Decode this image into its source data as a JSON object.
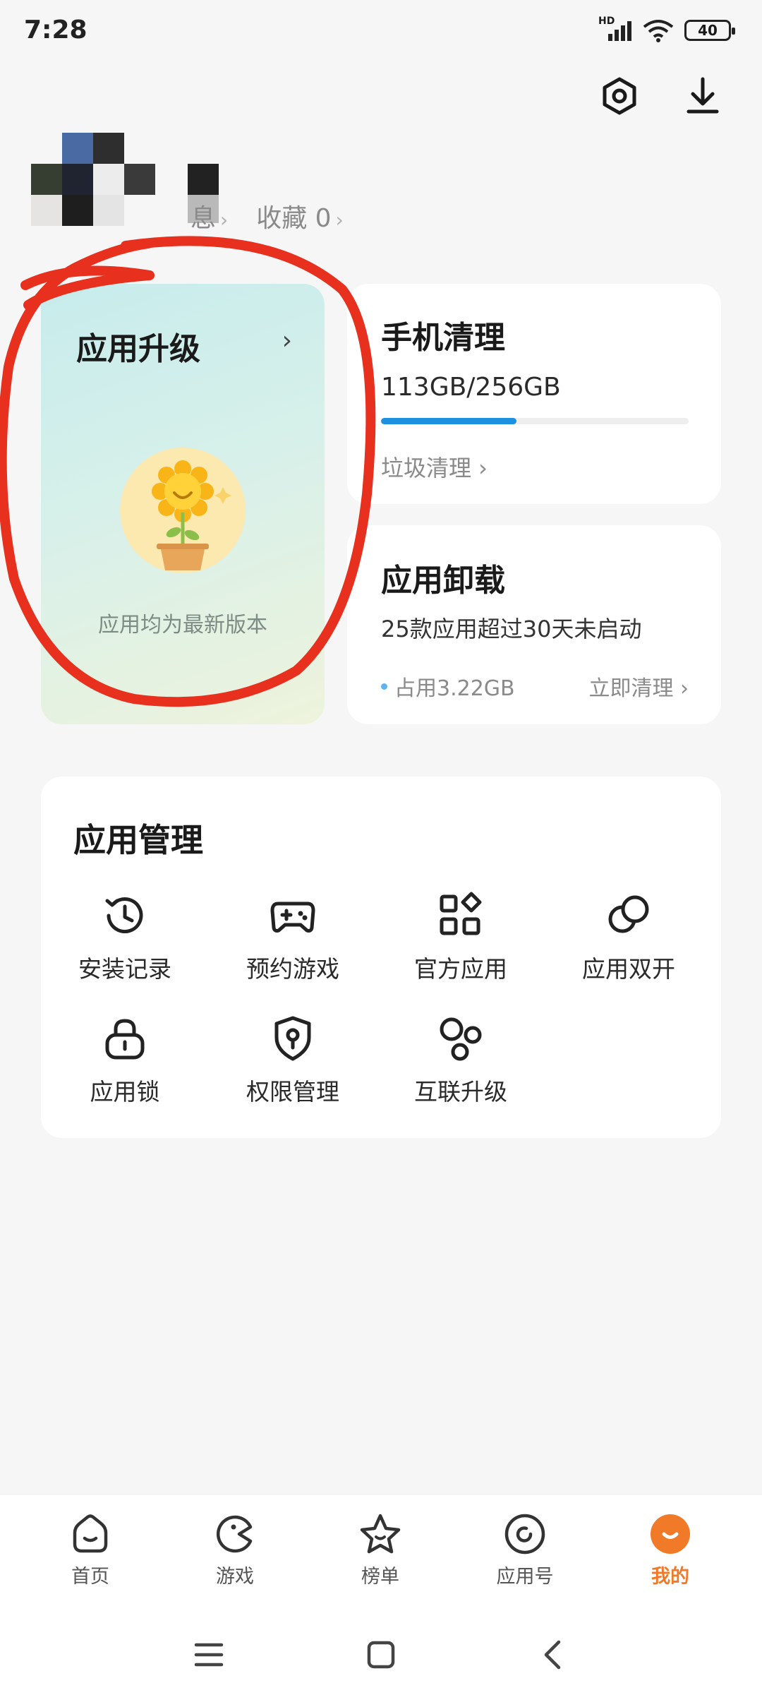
{
  "status_bar": {
    "time": "7:28",
    "hd": "HD",
    "battery": "40"
  },
  "profile": {
    "links": [
      {
        "label": "息"
      },
      {
        "label": "收藏 0"
      }
    ]
  },
  "upgrade_card": {
    "title": "应用升级",
    "subtitle": "应用均为最新版本"
  },
  "clean_card": {
    "title": "手机清理",
    "usage": "113GB/256GB",
    "used_fraction": 0.44,
    "link": "垃圾清理 ›"
  },
  "uninstall_card": {
    "title": "应用卸载",
    "desc": "25款应用超过30天未启动",
    "occupied": "占用3.22GB",
    "action": "立即清理 ›"
  },
  "app_manage": {
    "title": "应用管理",
    "items": [
      {
        "label": "安装记录",
        "icon": "history-icon"
      },
      {
        "label": "预约游戏",
        "icon": "gamepad-icon"
      },
      {
        "label": "官方应用",
        "icon": "apps-grid-icon"
      },
      {
        "label": "应用双开",
        "icon": "dual-app-icon"
      },
      {
        "label": "应用锁",
        "icon": "lock-icon"
      },
      {
        "label": "权限管理",
        "icon": "shield-key-icon"
      },
      {
        "label": "互联升级",
        "icon": "connect-icon"
      }
    ]
  },
  "bottom_nav": [
    {
      "label": "首页",
      "icon": "home-icon"
    },
    {
      "label": "游戏",
      "icon": "game-icon"
    },
    {
      "label": "榜单",
      "icon": "star-icon"
    },
    {
      "label": "应用号",
      "icon": "app-account-icon"
    },
    {
      "label": "我的",
      "icon": "profile-icon",
      "active": true
    }
  ],
  "colors": {
    "accent": "#f07a28",
    "progress": "#1e90e0",
    "annotation": "#e8301e"
  }
}
